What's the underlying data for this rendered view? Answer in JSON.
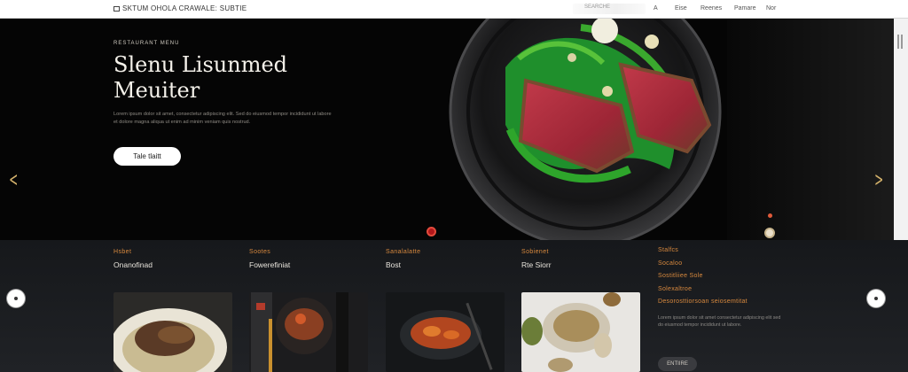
{
  "header": {
    "brand": "SKTUM OHOLA CRAWALE: SUBTIE",
    "search_placeholder": "SEARCHE",
    "nav": [
      "A",
      "Eise",
      "Reenes",
      "Pamare",
      "Nor"
    ]
  },
  "hero": {
    "eyebrow": "RESTAURANT MENU",
    "title_line1": "Slenu Lisunmed",
    "title_line2": "Meuiter",
    "description": "Lorem ipsum dolor sit amet, consectetur adipiscing elit. Sed do eiusmod tempor incididunt ut labore et dolore magna aliqua ut enim ad minim veniam quis nostrud.",
    "cta_label": "Tale tlaitt"
  },
  "categories": [
    {
      "label": "Hsbet",
      "name": "Onanofinad"
    },
    {
      "label": "Sootes",
      "name": "Fowerefiniat"
    },
    {
      "label": "Sanalalatte",
      "name": "Bost"
    },
    {
      "label": "Sobienet",
      "name": "Rte Siorr"
    }
  ],
  "feature": {
    "lines": [
      "Stalfcs",
      "Socaloo",
      "Sostitliiee Sole",
      "Solexaltroe"
    ],
    "headline": "Desorosttiorsoan seiosemtitat",
    "description": "Lorem ipsum dolor sit amet consectetur adipiscing elit sed do eiusmod tempor incididunt ut labore.",
    "button_label": "ENTIIRE"
  },
  "colors": {
    "accent": "#d8893e",
    "background": "#0b0b0c",
    "gold_arrow": "#d4b26b"
  }
}
